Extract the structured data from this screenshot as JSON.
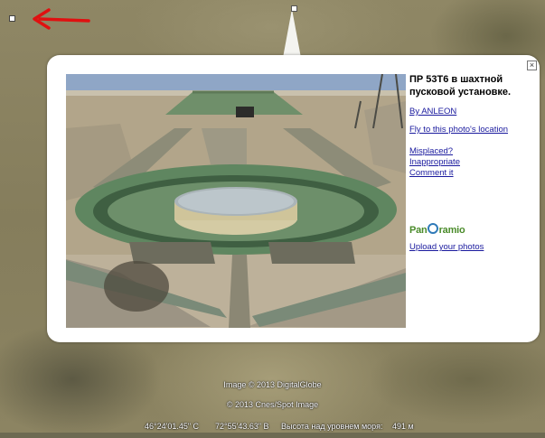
{
  "popup": {
    "close_symbol": "×",
    "title": "ПР 53Т6 в шахтной пусковой установке.",
    "author_link": "By ANLEON",
    "fly_link": "Fly to this photo's location",
    "misplaced_link": "Misplaced?",
    "inappropriate_link": "Inappropriate",
    "comment_link": "Comment it",
    "logo_prefix": "Pan",
    "logo_suffix": "ramio",
    "upload_link": "Upload your photos"
  },
  "attribution": {
    "imagery": "Image © 2013 DigitalGlobe",
    "cnes": "© 2013 Cnes/Spot Image"
  },
  "status": {
    "latitude": "46°24'01.45\" C",
    "longitude": "72°55'43.63\" B",
    "elevation_label": "Высота над уровнем моря:",
    "elevation_value": "491 м"
  },
  "colors": {
    "link": "#1a1a9e",
    "panoramio_green": "#4a8b2a",
    "panoramio_blue": "#2f7ab8",
    "pointer_arrow": "#e01010"
  },
  "icons": {
    "pointer": "red-arrow-icon",
    "placemark": "photo-placemark-icon",
    "close": "close-icon"
  }
}
